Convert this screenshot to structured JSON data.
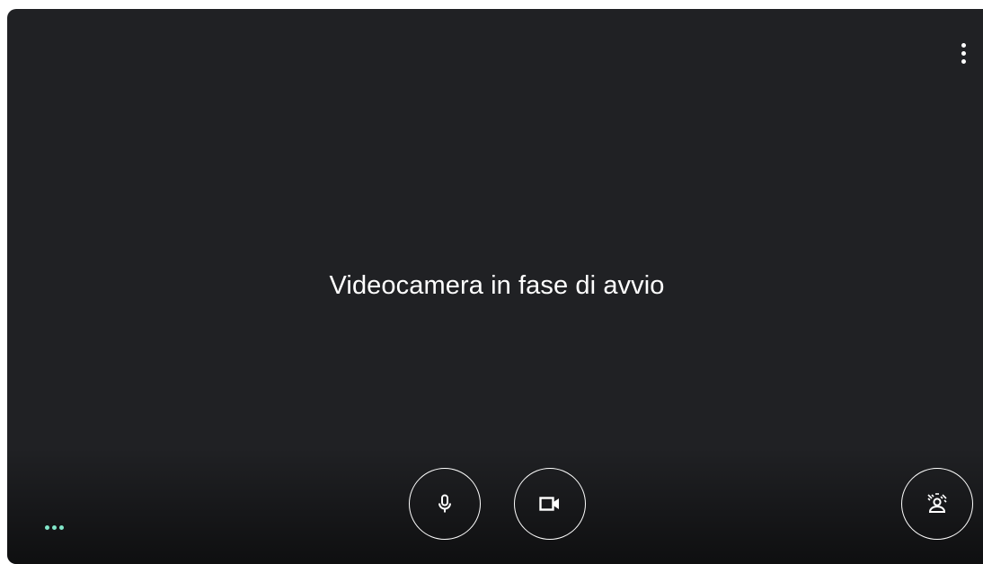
{
  "preview": {
    "status_text": "Videocamera in fase di avvio"
  },
  "icons": {
    "more": "more-vert-icon",
    "mic": "microphone-icon",
    "camera": "videocam-icon",
    "effects": "visual-effects-icon",
    "indicator": "three-dots-indicator-icon"
  },
  "colors": {
    "background": "#202124",
    "text": "#ffffff",
    "indicator": "#81e6c9"
  }
}
